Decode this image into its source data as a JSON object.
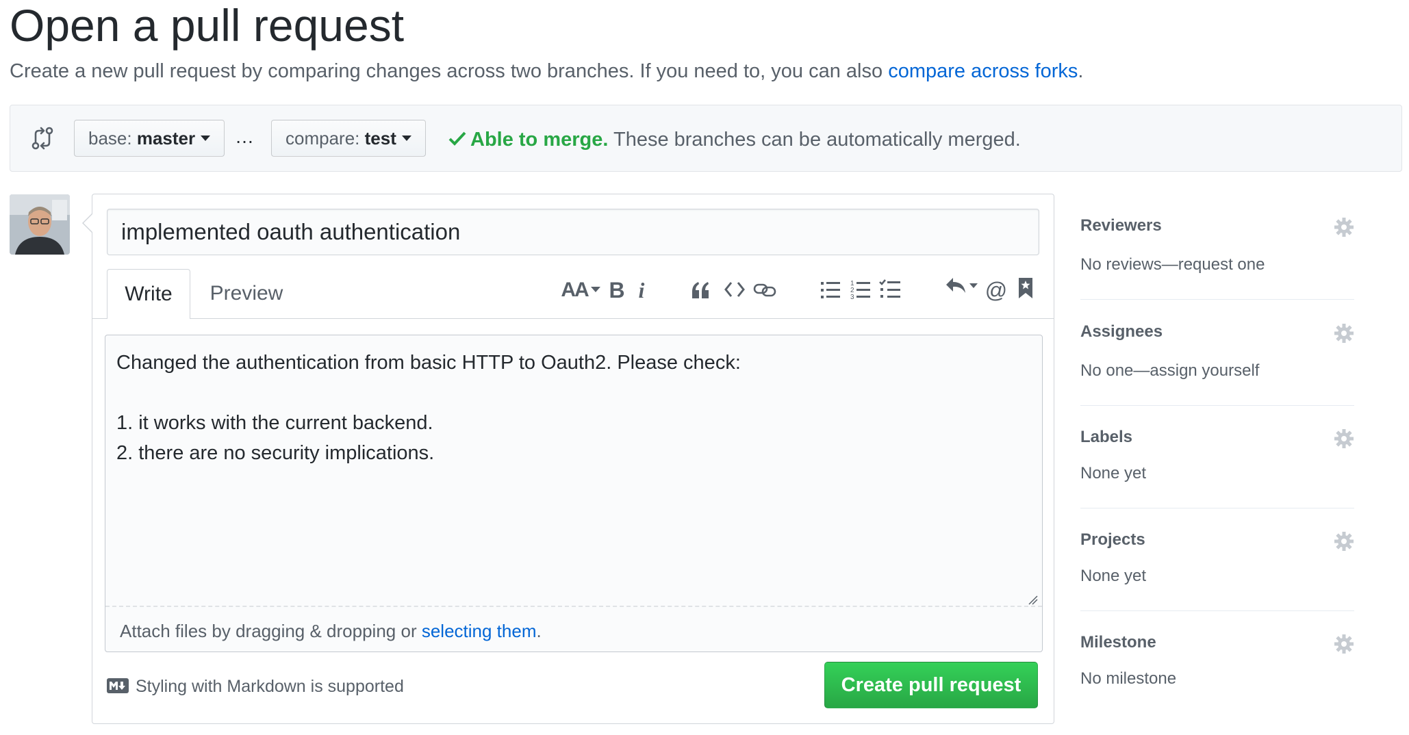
{
  "header": {
    "title": "Open a pull request",
    "subtitle_text": "Create a new pull request by comparing changes across two branches. If you need to, you can also",
    "subtitle_link": "compare across forks",
    "subtitle_end": "."
  },
  "compare": {
    "base_prefix": "base:",
    "base_branch": "master",
    "separator": "…",
    "compare_prefix": "compare:",
    "compare_branch": "test",
    "merge_ok": "Able to merge.",
    "merge_detail": "These branches can be automatically merged."
  },
  "form": {
    "title_value": "implemented oauth authentication",
    "tabs": [
      {
        "label": "Write",
        "selected": true
      },
      {
        "label": "Preview",
        "selected": false
      }
    ],
    "toolbar": [
      "header-text-icon",
      "bold-icon",
      "italic-icon",
      "quote-icon",
      "code-icon",
      "link-icon",
      "unordered-list-icon",
      "ordered-list-icon",
      "task-list-icon",
      "reply-icon",
      "mention-icon",
      "bookmark-icon"
    ],
    "toolbar_labels": {
      "header": "AA",
      "bold": "B",
      "italic": "i",
      "mention": "@"
    },
    "body_value": "Changed the authentication from basic HTTP to Oauth2. Please check:\n\n1. it works with the current backend.\n2. there are no security implications.",
    "attach_text": "Attach files by dragging & dropping or",
    "attach_link": "selecting them",
    "attach_end": ".",
    "markdown_note": "Styling with Markdown is supported",
    "submit_label": "Create pull request"
  },
  "sidebar": {
    "sections": [
      {
        "heading": "Reviewers",
        "value": "No reviews—request one"
      },
      {
        "heading": "Assignees",
        "value": "No one—assign yourself"
      },
      {
        "heading": "Labels",
        "value": "None yet"
      },
      {
        "heading": "Projects",
        "value": "None yet"
      },
      {
        "heading": "Milestone",
        "value": "No milestone"
      }
    ]
  },
  "colors": {
    "link": "#0366d6",
    "success": "#28a745",
    "text": "#24292e",
    "muted": "#586069"
  }
}
